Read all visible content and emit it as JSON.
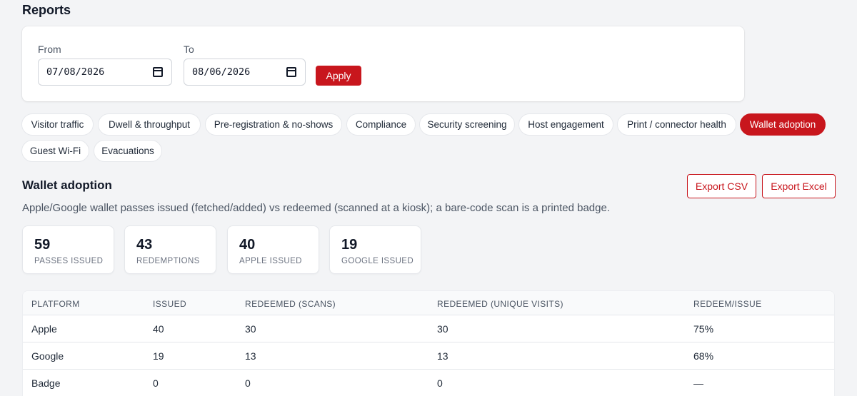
{
  "page": {
    "title": "Reports"
  },
  "filters": {
    "from_label": "From",
    "from_value": "07/08/2026",
    "to_label": "To",
    "to_value": "08/06/2026",
    "apply_label": "Apply"
  },
  "tabs": [
    {
      "label": "Visitor traffic",
      "active": false
    },
    {
      "label": "Dwell & throughput",
      "active": false
    },
    {
      "label": "Pre-registration & no-shows",
      "active": false
    },
    {
      "label": "Compliance",
      "active": false
    },
    {
      "label": "Security screening",
      "active": false
    },
    {
      "label": "Host engagement",
      "active": false
    },
    {
      "label": "Print / connector health",
      "active": false
    },
    {
      "label": "Wallet adoption",
      "active": true
    },
    {
      "label": "Guest Wi-Fi",
      "active": false
    },
    {
      "label": "Evacuations",
      "active": false
    }
  ],
  "section": {
    "title": "Wallet adoption",
    "description": "Apple/Google wallet passes issued (fetched/added) vs redeemed (scanned at a kiosk); a bare-code scan is a printed badge.",
    "export_csv": "Export CSV",
    "export_excel": "Export Excel"
  },
  "stats": [
    {
      "value": "59",
      "label": "PASSES ISSUED"
    },
    {
      "value": "43",
      "label": "REDEMPTIONS"
    },
    {
      "value": "40",
      "label": "APPLE ISSUED"
    },
    {
      "value": "19",
      "label": "GOOGLE ISSUED"
    }
  ],
  "table": {
    "headers": [
      "PLATFORM",
      "ISSUED",
      "REDEEMED (SCANS)",
      "REDEEMED (UNIQUE VISITS)",
      "REDEEM/ISSUE"
    ],
    "rows": [
      [
        "Apple",
        "40",
        "30",
        "30",
        "75%"
      ],
      [
        "Google",
        "19",
        "13",
        "13",
        "68%"
      ],
      [
        "Badge",
        "0",
        "0",
        "0",
        "—"
      ]
    ]
  },
  "colors": {
    "accent": "#c8161d",
    "background": "#f3f4f6"
  }
}
